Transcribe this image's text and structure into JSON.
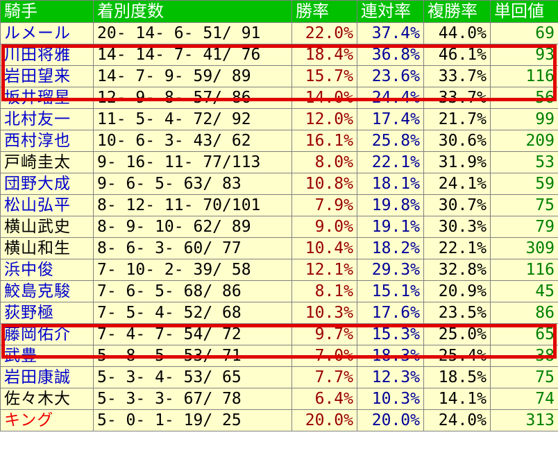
{
  "header": {
    "jockey": "騎手",
    "record": "着別度数",
    "win_rate": "勝率",
    "top2_rate": "連対率",
    "top3_rate": "複勝率",
    "win_return": "単回値"
  },
  "colors": {
    "header_bg": "#00c000",
    "row_bg": "#ffffcc",
    "name_blue": "#0000cc",
    "name_black": "#000000",
    "name_red": "#ee0000",
    "highlight_box": "#e00000"
  },
  "rows": [
    {
      "name": "ルメール",
      "name_color": "#0000cc",
      "record": "20- 14-  6- 51/ 91",
      "win": "22.0%",
      "top2": "37.4%",
      "top3": "44.0%",
      "ret": "69"
    },
    {
      "name": "川田将雅",
      "name_color": "#0000cc",
      "record": "14- 14-  7- 41/ 76",
      "win": "18.4%",
      "top2": "36.8%",
      "top3": "46.1%",
      "ret": "93"
    },
    {
      "name": "岩田望来",
      "name_color": "#0000cc",
      "record": "14-  7-  9- 59/ 89",
      "win": "15.7%",
      "top2": "23.6%",
      "top3": "33.7%",
      "ret": "116"
    },
    {
      "name": "坂井瑠星",
      "name_color": "#0000cc",
      "record": "12-  9-  8- 57/ 86",
      "win": "14.0%",
      "top2": "24.4%",
      "top3": "33.7%",
      "ret": "56"
    },
    {
      "name": "北村友一",
      "name_color": "#0000cc",
      "record": "11-  5-  4- 72/ 92",
      "win": "12.0%",
      "top2": "17.4%",
      "top3": "21.7%",
      "ret": "99"
    },
    {
      "name": "西村淳也",
      "name_color": "#0000cc",
      "record": "10-  6-  3- 43/ 62",
      "win": "16.1%",
      "top2": "25.8%",
      "top3": "30.6%",
      "ret": "209"
    },
    {
      "name": "戸崎圭太",
      "name_color": "#000000",
      "record": " 9- 16- 11- 77/113",
      "win": "8.0%",
      "top2": "22.1%",
      "top3": "31.9%",
      "ret": "53"
    },
    {
      "name": "団野大成",
      "name_color": "#0000cc",
      "record": " 9-  6-  5- 63/ 83",
      "win": "10.8%",
      "top2": "18.1%",
      "top3": "24.1%",
      "ret": "59"
    },
    {
      "name": "松山弘平",
      "name_color": "#0000cc",
      "record": " 8- 12- 11- 70/101",
      "win": "7.9%",
      "top2": "19.8%",
      "top3": "30.7%",
      "ret": "75"
    },
    {
      "name": "横山武史",
      "name_color": "#000000",
      "record": " 8-  9- 10- 62/ 89",
      "win": "9.0%",
      "top2": "19.1%",
      "top3": "30.3%",
      "ret": "79"
    },
    {
      "name": "横山和生",
      "name_color": "#000000",
      "record": " 8-  6-  3- 60/ 77",
      "win": "10.4%",
      "top2": "18.2%",
      "top3": "22.1%",
      "ret": "309"
    },
    {
      "name": "浜中俊",
      "name_color": "#0000cc",
      "record": " 7- 10-  2- 39/ 58",
      "win": "12.1%",
      "top2": "29.3%",
      "top3": "32.8%",
      "ret": "116"
    },
    {
      "name": "鮫島克駿",
      "name_color": "#0000cc",
      "record": " 7-  6-  5- 68/ 86",
      "win": "8.1%",
      "top2": "15.1%",
      "top3": "20.9%",
      "ret": "45"
    },
    {
      "name": "荻野極",
      "name_color": "#0000cc",
      "record": " 7-  5-  4- 52/ 68",
      "win": "10.3%",
      "top2": "17.6%",
      "top3": "23.5%",
      "ret": "86"
    },
    {
      "name": "藤岡佑介",
      "name_color": "#0000cc",
      "record": " 7-  4-  7- 54/ 72",
      "win": "9.7%",
      "top2": "15.3%",
      "top3": "25.0%",
      "ret": "65"
    },
    {
      "name": "武豊",
      "name_color": "#0000cc",
      "record": " 5-  8-  5- 53/ 71",
      "win": "7.0%",
      "top2": "18.3%",
      "top3": "25.4%",
      "ret": "38"
    },
    {
      "name": "岩田康誠",
      "name_color": "#0000cc",
      "record": " 5-  3-  4- 53/ 65",
      "win": "7.7%",
      "top2": "12.3%",
      "top3": "18.5%",
      "ret": "75"
    },
    {
      "name": "佐々木大",
      "name_color": "#000000",
      "record": " 5-  3-  3- 67/ 78",
      "win": "6.4%",
      "top2": "10.3%",
      "top3": "14.1%",
      "ret": "74"
    },
    {
      "name": "キング",
      "name_color": "#ee0000",
      "record": " 5-  0-  1- 19/ 25",
      "win": "20.0%",
      "top2": "20.0%",
      "top3": "24.0%",
      "ret": "313"
    }
  ]
}
